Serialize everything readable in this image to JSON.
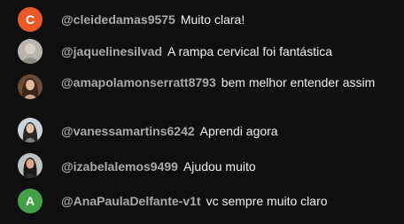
{
  "colors": {
    "background": "#0f0f0f",
    "author": "#aaaaaa",
    "message": "#f1f1f1"
  },
  "messages": [
    {
      "avatar": {
        "type": "letter",
        "letter": "C",
        "color": "#e9592a"
      },
      "author": "@cleidedamas9575",
      "text": "Muito clara!"
    },
    {
      "avatar": {
        "type": "photo",
        "icon": "user-photo-icon"
      },
      "author": "@jaquelinesilvad",
      "text": "A rampa cervical foi fantástica"
    },
    {
      "avatar": {
        "type": "photo",
        "icon": "user-photo-icon"
      },
      "author": "@amapolamonserratt8793",
      "text": "bem melhor entender assim"
    },
    {
      "avatar": {
        "type": "photo",
        "icon": "user-photo-icon"
      },
      "author": "@vanessamartins6242",
      "text": "Aprendi agora"
    },
    {
      "avatar": {
        "type": "photo",
        "icon": "user-photo-icon"
      },
      "author": "@izabelalemos9499",
      "text": "Ajudou muito"
    },
    {
      "avatar": {
        "type": "letter",
        "letter": "A",
        "color": "#43a047"
      },
      "author": "@AnaPaulaDelfante-v1t",
      "text": "vc sempre muito claro"
    }
  ]
}
